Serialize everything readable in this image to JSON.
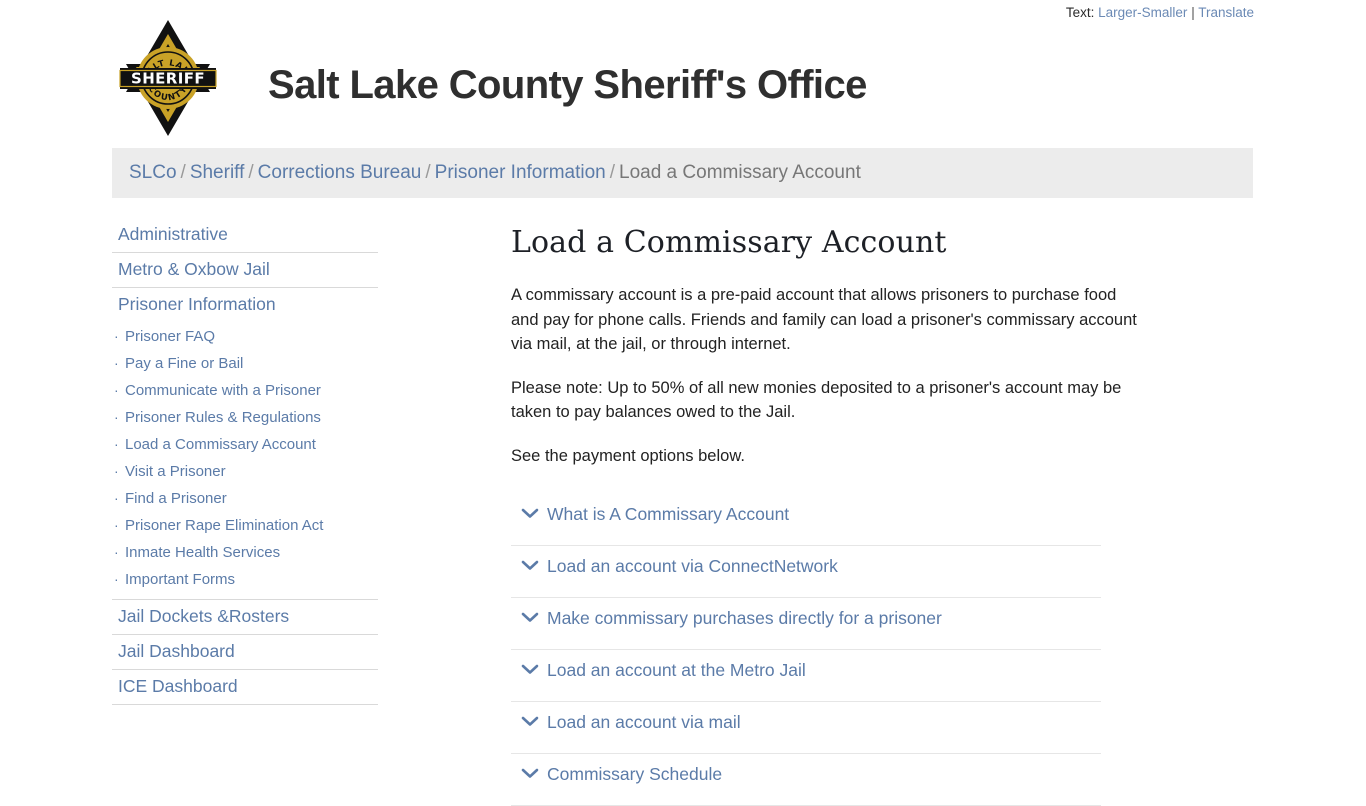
{
  "utility": {
    "label": "Text:",
    "larger": "Larger",
    "separator": "-",
    "smaller": "Smaller",
    "pipe": "|",
    "translate": "Translate"
  },
  "masthead": {
    "site_title": "Salt Lake County Sheriff's Office",
    "badge": {
      "name": "sheriff-badge-icon",
      "top_text": "SALT LAKE",
      "center_text": "SHERIFF",
      "bottom_text": "COUNTY",
      "gold": "#c9a227",
      "black": "#111111"
    }
  },
  "breadcrumb": {
    "separator": "/",
    "items": [
      {
        "label": "SLCo",
        "current": false
      },
      {
        "label": "Sheriff",
        "current": false
      },
      {
        "label": "Corrections Bureau",
        "current": false
      },
      {
        "label": "Prisoner Information",
        "current": false
      },
      {
        "label": "Load a Commissary Account",
        "current": true
      }
    ]
  },
  "sidebar": {
    "sections": [
      {
        "label": "Administrative",
        "children": []
      },
      {
        "label": "Metro & Oxbow Jail",
        "children": []
      },
      {
        "label": "Prisoner Information",
        "children": [
          "Prisoner FAQ",
          "Pay a Fine or Bail",
          "Communicate with a Prisoner",
          "Prisoner Rules & Regulations",
          "Load a Commissary Account",
          "Visit a Prisoner",
          "Find a Prisoner",
          "Prisoner Rape Elimination Act",
          "Inmate Health Services",
          "Important Forms"
        ]
      },
      {
        "label": "Jail Dockets &Rosters",
        "children": []
      },
      {
        "label": "Jail Dashboard",
        "children": []
      },
      {
        "label": "ICE Dashboard",
        "children": []
      }
    ],
    "bullet": "·"
  },
  "main": {
    "title": "Load a Commissary Account",
    "paragraphs": [
      "A commissary account is a pre-paid account that allows prisoners to purchase food and pay for phone calls. Friends and family can load a prisoner's commissary account via mail, at the jail, or through internet.",
      "Please note: Up to 50% of all new monies deposited to a prisoner's account may be taken to pay balances owed to the Jail.",
      "See the payment options below."
    ],
    "accordion": [
      {
        "label": "What is A Commissary Account",
        "expanded": false
      },
      {
        "label": "Load an account via ConnectNetwork",
        "expanded": false
      },
      {
        "label": "Make commissary purchases directly for a prisoner",
        "expanded": false
      },
      {
        "label": "Load an account at the Metro Jail",
        "expanded": false
      },
      {
        "label": "Load an account via mail",
        "expanded": false
      },
      {
        "label": "Commissary Schedule",
        "expanded": false
      }
    ]
  },
  "colors": {
    "link": "#5b7ba8",
    "breadcrumb_bg": "#ececec",
    "text": "#222222",
    "divider": "#e6e6e6"
  }
}
